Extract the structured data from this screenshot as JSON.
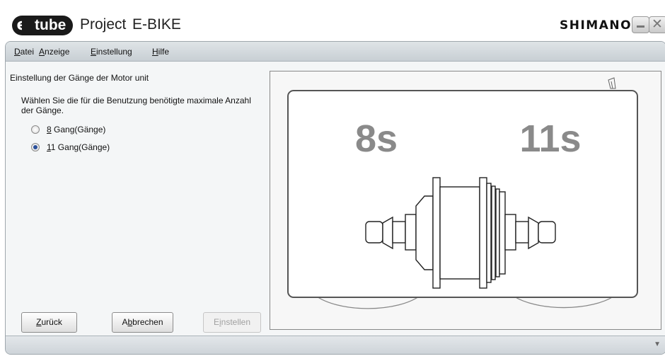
{
  "window": {
    "logo_e": "e",
    "logo_text": "tube",
    "project_label": "Project",
    "product_label": "E-BIKE",
    "brand": "SHIMANO"
  },
  "menu": [
    {
      "label": "Datei"
    },
    {
      "label": "Anzeige"
    },
    {
      "label": "Einstellung"
    },
    {
      "label": "Hilfe"
    }
  ],
  "page": {
    "section_title": "Einstellung der Gänge der Motor unit",
    "instruction": "Wählen Sie die für die Benutzung benötigte maximale Anzahl der Gänge.",
    "options": [
      {
        "label": "8 Gang(Gänge)",
        "selected": false
      },
      {
        "label": "11 Gang(Gänge)",
        "selected": true
      }
    ]
  },
  "illustration": {
    "left_label": "8s",
    "right_label": "11s"
  },
  "buttons": {
    "back": {
      "pre": "",
      "key": "Z",
      "post": "urück"
    },
    "cancel": {
      "pre": "A",
      "key": "b",
      "post": "brechen"
    },
    "apply": {
      "pre": "E",
      "key": "i",
      "post": "nstellen",
      "enabled": false
    }
  },
  "colors": {
    "radio_selected": "#2a4f9a",
    "frame": "#9fa7ad",
    "illustration_text": "#8a8a8a"
  }
}
